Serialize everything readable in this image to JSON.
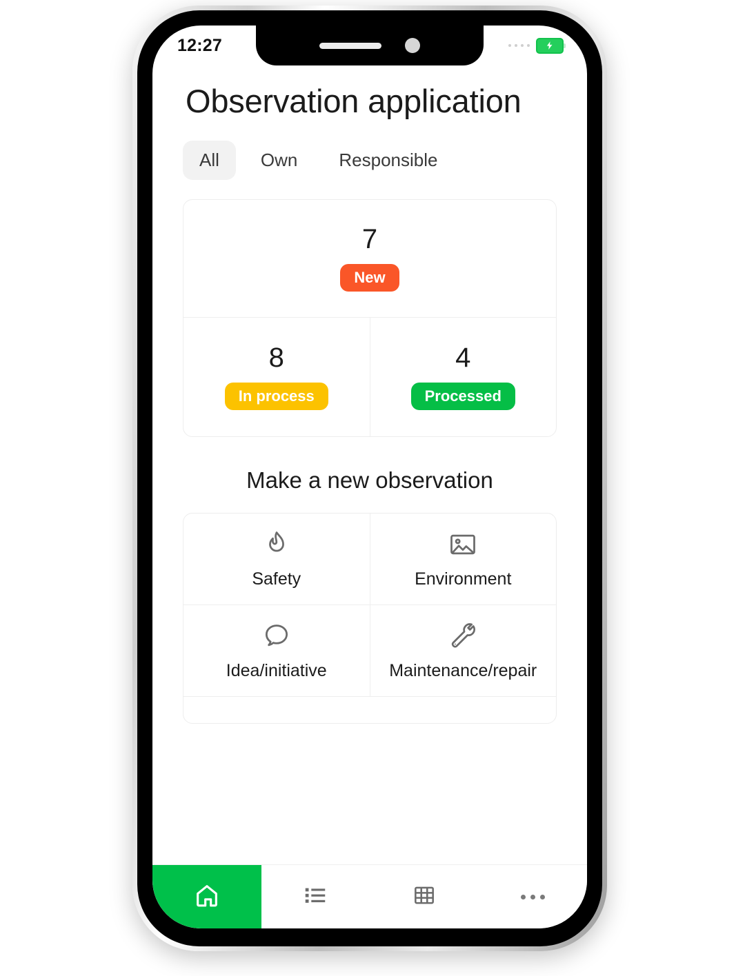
{
  "status_bar": {
    "time": "12:27",
    "signal_icon": "signal-dots-icon",
    "battery_icon": "battery-charging-icon"
  },
  "header": {
    "title": "Observation application"
  },
  "filter_tabs": {
    "active": "All",
    "items": [
      {
        "label": "All",
        "active": true
      },
      {
        "label": "Own",
        "active": false
      },
      {
        "label": "Responsible",
        "active": false
      }
    ]
  },
  "stats": {
    "new": {
      "count": "7",
      "label": "New",
      "color": "#fa5628"
    },
    "in_process": {
      "count": "8",
      "label": "In process",
      "color": "#fcc200"
    },
    "processed": {
      "count": "4",
      "label": "Processed",
      "color": "#05be46"
    }
  },
  "new_observation": {
    "heading": "Make a new observation",
    "options": [
      {
        "label": "Safety",
        "icon": "flame-icon"
      },
      {
        "label": "Environment",
        "icon": "image-icon"
      },
      {
        "label": "Idea/initiative",
        "icon": "speech-bubble-icon"
      },
      {
        "label": "Maintenance/repair",
        "icon": "wrench-icon"
      }
    ]
  },
  "bottom_nav": {
    "active_color": "#00c04a",
    "items": [
      {
        "name": "home",
        "icon": "home-icon",
        "active": true
      },
      {
        "name": "list",
        "icon": "list-icon",
        "active": false
      },
      {
        "name": "grid",
        "icon": "grid-icon",
        "active": false
      },
      {
        "name": "more",
        "icon": "more-dots-icon",
        "active": false
      }
    ]
  }
}
